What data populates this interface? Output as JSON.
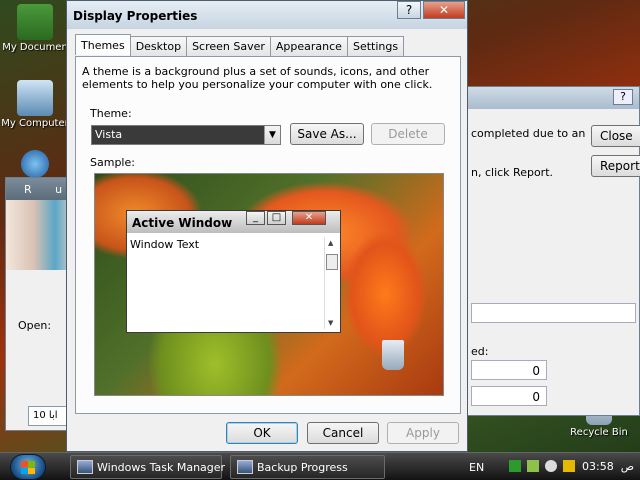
{
  "desktop": {
    "icons": [
      "My Documen",
      "My Computer"
    ],
    "recycle_bin": "Recycle Bin"
  },
  "run_window": {
    "title": "R u",
    "open_label": "Open:",
    "input_value": "10  ابا"
  },
  "report_window": {
    "text_line1": "completed due to an",
    "text_line2": "n, click Report.",
    "close_label": "Close",
    "report_label": "Report",
    "label_partial": "ed:",
    "value1": "0",
    "value2": "0"
  },
  "dialog": {
    "title": "Display Properties",
    "help_glyph": "?",
    "close_glyph": "✕",
    "tabs": [
      "Themes",
      "Desktop",
      "Screen Saver",
      "Appearance",
      "Settings"
    ],
    "active_tab": "Themes",
    "description": "A theme is a background plus a set of sounds, icons, and other elements to help you personalize your computer with one click.",
    "theme_label": "Theme:",
    "theme_value": "Vista",
    "save_as_label": "Save As...",
    "delete_label": "Delete",
    "sample_label": "Sample:",
    "sample_window": {
      "title": "Active Window",
      "text": "Window Text"
    },
    "ok_label": "OK",
    "cancel_label": "Cancel",
    "apply_label": "Apply"
  },
  "taskbar": {
    "tasks": [
      "Windows Task Manager",
      "Backup Progress"
    ],
    "language": "EN",
    "time": "03:58",
    "ampm": "ص"
  },
  "colors": {
    "close_red": "#c03c20",
    "selection_dark": "#3a3a3a",
    "taskbar": "#1e1e1e"
  }
}
